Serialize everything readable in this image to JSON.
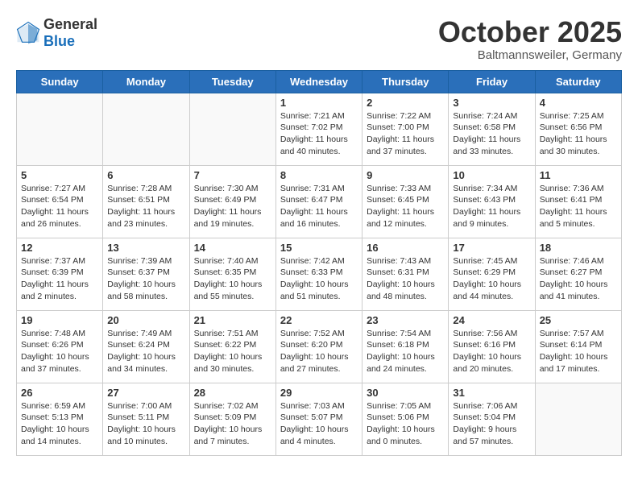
{
  "header": {
    "logo_general": "General",
    "logo_blue": "Blue",
    "month": "October 2025",
    "location": "Baltmannsweiler, Germany"
  },
  "days_of_week": [
    "Sunday",
    "Monday",
    "Tuesday",
    "Wednesday",
    "Thursday",
    "Friday",
    "Saturday"
  ],
  "weeks": [
    [
      {
        "day": "",
        "info": ""
      },
      {
        "day": "",
        "info": ""
      },
      {
        "day": "",
        "info": ""
      },
      {
        "day": "1",
        "info": "Sunrise: 7:21 AM\nSunset: 7:02 PM\nDaylight: 11 hours\nand 40 minutes."
      },
      {
        "day": "2",
        "info": "Sunrise: 7:22 AM\nSunset: 7:00 PM\nDaylight: 11 hours\nand 37 minutes."
      },
      {
        "day": "3",
        "info": "Sunrise: 7:24 AM\nSunset: 6:58 PM\nDaylight: 11 hours\nand 33 minutes."
      },
      {
        "day": "4",
        "info": "Sunrise: 7:25 AM\nSunset: 6:56 PM\nDaylight: 11 hours\nand 30 minutes."
      }
    ],
    [
      {
        "day": "5",
        "info": "Sunrise: 7:27 AM\nSunset: 6:54 PM\nDaylight: 11 hours\nand 26 minutes."
      },
      {
        "day": "6",
        "info": "Sunrise: 7:28 AM\nSunset: 6:51 PM\nDaylight: 11 hours\nand 23 minutes."
      },
      {
        "day": "7",
        "info": "Sunrise: 7:30 AM\nSunset: 6:49 PM\nDaylight: 11 hours\nand 19 minutes."
      },
      {
        "day": "8",
        "info": "Sunrise: 7:31 AM\nSunset: 6:47 PM\nDaylight: 11 hours\nand 16 minutes."
      },
      {
        "day": "9",
        "info": "Sunrise: 7:33 AM\nSunset: 6:45 PM\nDaylight: 11 hours\nand 12 minutes."
      },
      {
        "day": "10",
        "info": "Sunrise: 7:34 AM\nSunset: 6:43 PM\nDaylight: 11 hours\nand 9 minutes."
      },
      {
        "day": "11",
        "info": "Sunrise: 7:36 AM\nSunset: 6:41 PM\nDaylight: 11 hours\nand 5 minutes."
      }
    ],
    [
      {
        "day": "12",
        "info": "Sunrise: 7:37 AM\nSunset: 6:39 PM\nDaylight: 11 hours\nand 2 minutes."
      },
      {
        "day": "13",
        "info": "Sunrise: 7:39 AM\nSunset: 6:37 PM\nDaylight: 10 hours\nand 58 minutes."
      },
      {
        "day": "14",
        "info": "Sunrise: 7:40 AM\nSunset: 6:35 PM\nDaylight: 10 hours\nand 55 minutes."
      },
      {
        "day": "15",
        "info": "Sunrise: 7:42 AM\nSunset: 6:33 PM\nDaylight: 10 hours\nand 51 minutes."
      },
      {
        "day": "16",
        "info": "Sunrise: 7:43 AM\nSunset: 6:31 PM\nDaylight: 10 hours\nand 48 minutes."
      },
      {
        "day": "17",
        "info": "Sunrise: 7:45 AM\nSunset: 6:29 PM\nDaylight: 10 hours\nand 44 minutes."
      },
      {
        "day": "18",
        "info": "Sunrise: 7:46 AM\nSunset: 6:27 PM\nDaylight: 10 hours\nand 41 minutes."
      }
    ],
    [
      {
        "day": "19",
        "info": "Sunrise: 7:48 AM\nSunset: 6:26 PM\nDaylight: 10 hours\nand 37 minutes."
      },
      {
        "day": "20",
        "info": "Sunrise: 7:49 AM\nSunset: 6:24 PM\nDaylight: 10 hours\nand 34 minutes."
      },
      {
        "day": "21",
        "info": "Sunrise: 7:51 AM\nSunset: 6:22 PM\nDaylight: 10 hours\nand 30 minutes."
      },
      {
        "day": "22",
        "info": "Sunrise: 7:52 AM\nSunset: 6:20 PM\nDaylight: 10 hours\nand 27 minutes."
      },
      {
        "day": "23",
        "info": "Sunrise: 7:54 AM\nSunset: 6:18 PM\nDaylight: 10 hours\nand 24 minutes."
      },
      {
        "day": "24",
        "info": "Sunrise: 7:56 AM\nSunset: 6:16 PM\nDaylight: 10 hours\nand 20 minutes."
      },
      {
        "day": "25",
        "info": "Sunrise: 7:57 AM\nSunset: 6:14 PM\nDaylight: 10 hours\nand 17 minutes."
      }
    ],
    [
      {
        "day": "26",
        "info": "Sunrise: 6:59 AM\nSunset: 5:13 PM\nDaylight: 10 hours\nand 14 minutes."
      },
      {
        "day": "27",
        "info": "Sunrise: 7:00 AM\nSunset: 5:11 PM\nDaylight: 10 hours\nand 10 minutes."
      },
      {
        "day": "28",
        "info": "Sunrise: 7:02 AM\nSunset: 5:09 PM\nDaylight: 10 hours\nand 7 minutes."
      },
      {
        "day": "29",
        "info": "Sunrise: 7:03 AM\nSunset: 5:07 PM\nDaylight: 10 hours\nand 4 minutes."
      },
      {
        "day": "30",
        "info": "Sunrise: 7:05 AM\nSunset: 5:06 PM\nDaylight: 10 hours\nand 0 minutes."
      },
      {
        "day": "31",
        "info": "Sunrise: 7:06 AM\nSunset: 5:04 PM\nDaylight: 9 hours\nand 57 minutes."
      },
      {
        "day": "",
        "info": ""
      }
    ]
  ]
}
